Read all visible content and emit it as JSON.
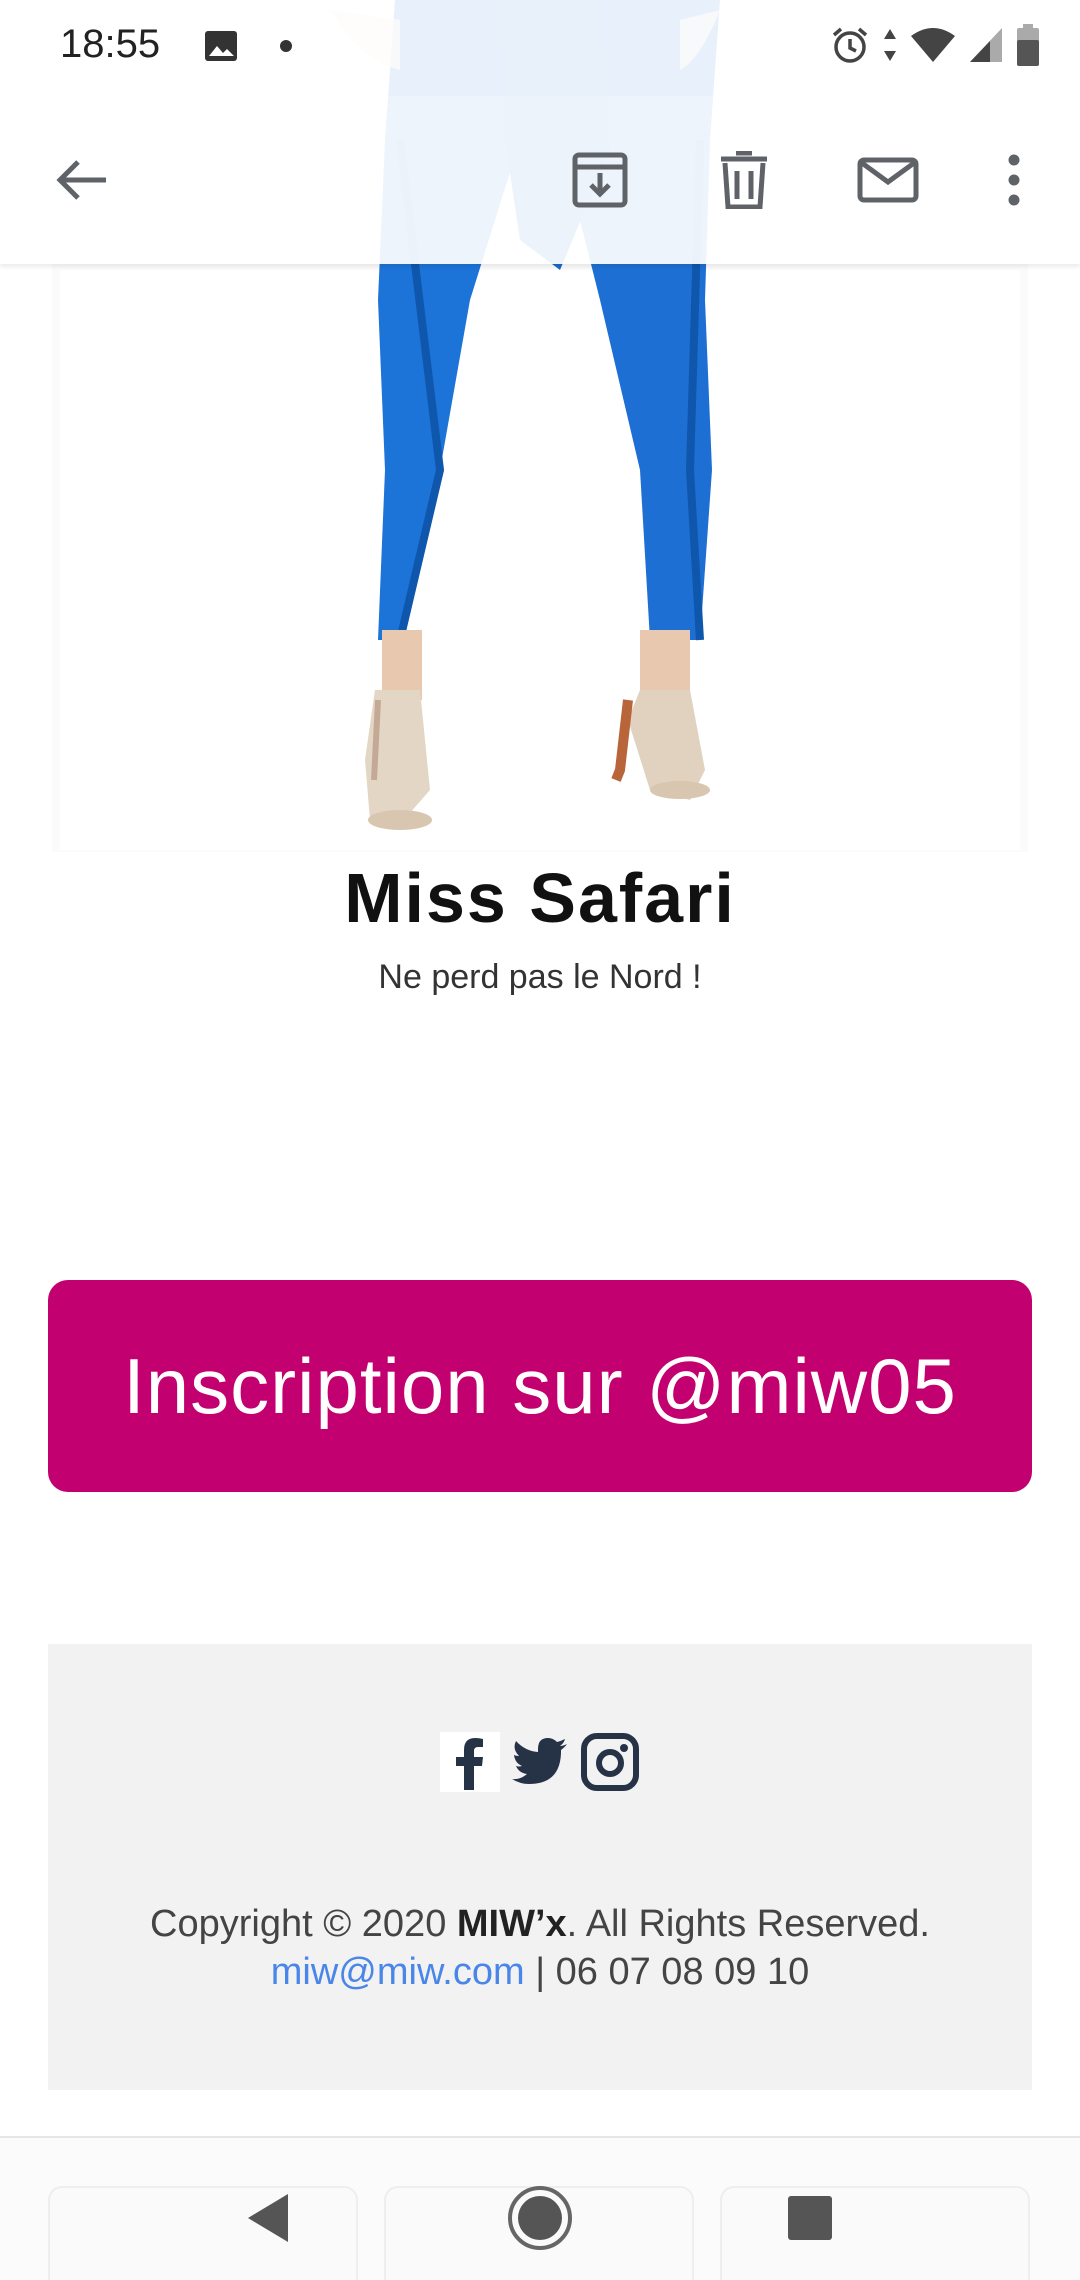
{
  "status_bar": {
    "time": "18:55",
    "icons": [
      "gallery-icon",
      "notification-dot",
      "alarm-icon",
      "data-arrows-icon",
      "wifi-icon",
      "signal-icon",
      "battery-icon"
    ]
  },
  "toolbar": {
    "icons": [
      "back-arrow-icon",
      "archive-icon",
      "delete-icon",
      "mark-unread-icon",
      "more-options-icon"
    ]
  },
  "email": {
    "product_title": "Miss Safari",
    "product_subtitle": "Ne perd pas le Nord !",
    "cta_label": "Inscription sur @miw05",
    "cta_color": "#c3006f",
    "footer": {
      "social_icons": [
        "facebook-icon",
        "twitter-icon",
        "instagram-icon"
      ],
      "copyright_prefix": "Copyright © 2020 ",
      "brand": "MIW’x",
      "copyright_suffix": ". All Rights Reserved.",
      "email": "miw@miw.com",
      "separator": " | ",
      "phone": "06 07 08 09 10"
    }
  },
  "nav_bar": {
    "icons": [
      "back-triangle-icon",
      "home-circle-icon",
      "recents-square-icon"
    ]
  }
}
